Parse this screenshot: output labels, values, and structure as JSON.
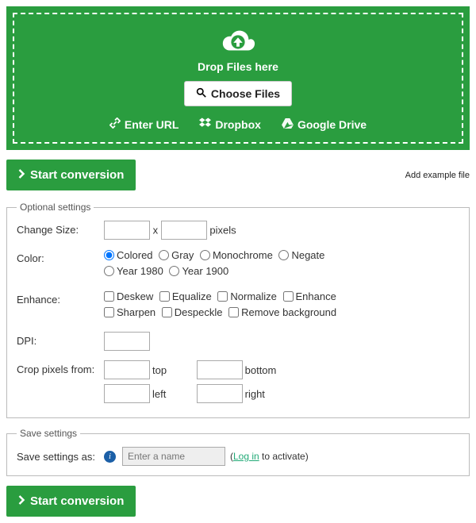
{
  "dropzone": {
    "drop_text": "Drop Files here",
    "choose_label": "Choose Files",
    "sources": {
      "url": "Enter URL",
      "dropbox": "Dropbox",
      "gdrive": "Google Drive"
    }
  },
  "buttons": {
    "start_conversion": "Start conversion",
    "add_example": "Add example file"
  },
  "optional": {
    "legend": "Optional settings",
    "size": {
      "label": "Change Size:",
      "separator": "x",
      "unit": "pixels"
    },
    "color": {
      "label": "Color:",
      "options": [
        "Colored",
        "Gray",
        "Monochrome",
        "Negate",
        "Year 1980",
        "Year 1900"
      ],
      "selected": "Colored"
    },
    "enhance": {
      "label": "Enhance:",
      "options": [
        "Deskew",
        "Equalize",
        "Normalize",
        "Enhance",
        "Sharpen",
        "Despeckle",
        "Remove background"
      ]
    },
    "dpi": {
      "label": "DPI:"
    },
    "crop": {
      "label": "Crop pixels from:",
      "sides": {
        "top": "top",
        "bottom": "bottom",
        "left": "left",
        "right": "right"
      }
    }
  },
  "save": {
    "legend": "Save settings",
    "label": "Save settings as:",
    "placeholder": "Enter a name",
    "hint_prefix": "(",
    "hint_link": "Log in",
    "hint_suffix": " to activate)"
  }
}
